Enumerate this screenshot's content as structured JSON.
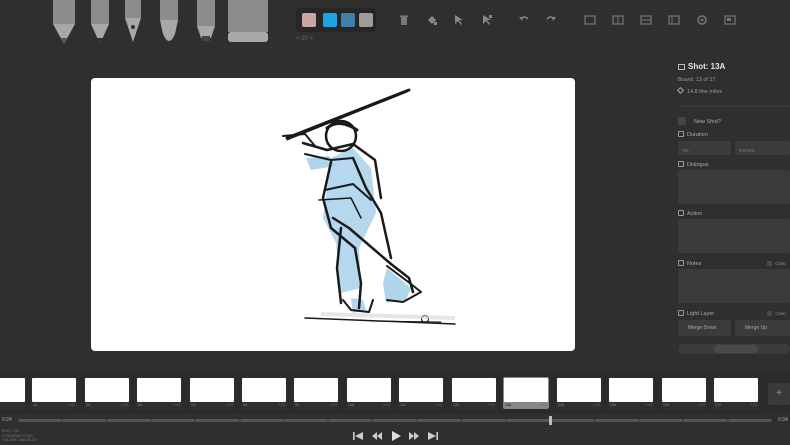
{
  "toolbar": {
    "brushes": [
      "light-pencil-icon",
      "pencil-icon",
      "pen-icon",
      "brush-icon",
      "note-pen-icon",
      "eraser-icon"
    ],
    "colors": [
      "#c9a79f",
      "#1ca3e0",
      "#3f7faa",
      "#9d9d9d"
    ],
    "size_readout": "< 20 >",
    "actions": [
      "trash-icon",
      "fill-icon",
      "move-icon",
      "scale-icon",
      "undo-icon",
      "redo-icon"
    ],
    "layouts": [
      "layout-1-icon",
      "layout-2-icon",
      "layout-3-icon",
      "layout-4-icon",
      "settings-icon",
      "export-icon"
    ]
  },
  "panel": {
    "shot_label": "Shot: 13A",
    "board_info": "Board: 13 of 17",
    "line_miles": "14.8 line miles",
    "new_shot_label": "New Shot?",
    "duration_label": "Duration",
    "duration_ms_placeholder": "ms",
    "duration_frames_placeholder": "frames",
    "dialogue_label": "Dialogue",
    "action_label": "Action",
    "notes_label": "Notes",
    "notes_clear": "Clear",
    "light_layer_label": "Light Layer",
    "light_layer_clear": "Clear",
    "merge_down": "Merge Down",
    "merge_up": "Merge Up"
  },
  "filmstrip": {
    "boards": [
      {
        "name": "",
        "dur": ""
      },
      {
        "name": "2A",
        "dur": "0:04"
      },
      {
        "name": "3A",
        "dur": "0:04"
      },
      {
        "name": "6A",
        "dur": "0:04"
      },
      {
        "name": "7A",
        "dur": "0:04"
      },
      {
        "name": "8A",
        "dur": "0:04"
      },
      {
        "name": "9A",
        "dur": "0:04"
      },
      {
        "name": "10A",
        "dur": "0:04"
      },
      {
        "name": "11A",
        "dur": "0:04"
      },
      {
        "name": "12A",
        "dur": "0:04"
      },
      {
        "name": "13A",
        "dur": "0:04"
      },
      {
        "name": "14A",
        "dur": "0:04"
      },
      {
        "name": "15A",
        "dur": "0:04"
      },
      {
        "name": "16A",
        "dur": "0:04"
      },
      {
        "name": "17A",
        "dur": "0:04"
      }
    ],
    "active_index": 10,
    "add_label": "+"
  },
  "timeline": {
    "time_left": "0:24",
    "time_right": "0:34",
    "meta_lines": [
      "SHOT 13A",
      "17 BOARDS TOTAL",
      "VOLUME LINE MILES"
    ],
    "transport": [
      "skip-back-icon",
      "rewind-icon",
      "play-icon",
      "fast-forward-icon",
      "skip-forward-icon"
    ]
  },
  "colors": {
    "background": "#2f2f2f",
    "canvas": "#ffffff",
    "sketch_blue": "#9ccbe8",
    "sketch_ink": "#1a1a1a"
  }
}
